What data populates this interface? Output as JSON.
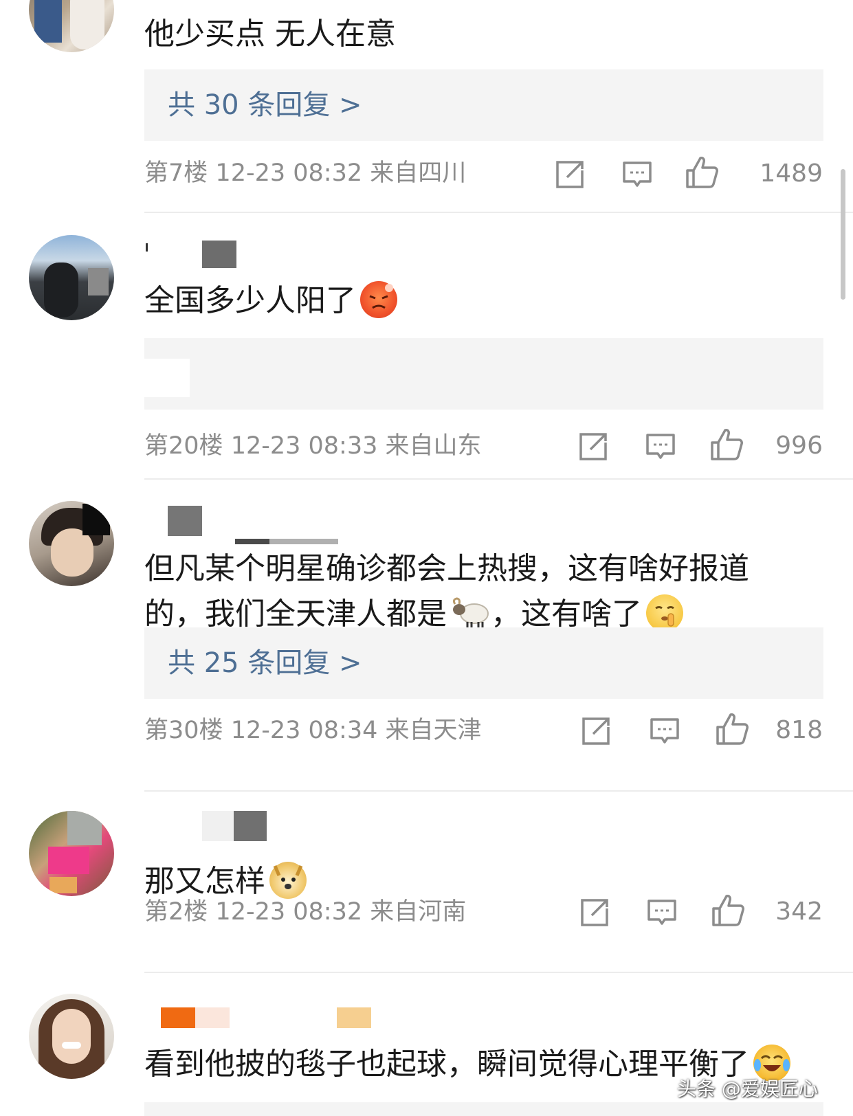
{
  "comments": [
    {
      "text": "他少买点 无人在意",
      "reply_link": "共 30 条回复 >",
      "floor": "第7楼",
      "time": "12-23 08:32",
      "location": "来自四川",
      "likes": "1489"
    },
    {
      "text": "全国多少人阳了",
      "emoji": "angry-face-emoji",
      "floor": "第20楼",
      "time": "12-23 08:33",
      "location": "来自山东",
      "likes": "996"
    },
    {
      "text_line1": "但凡某个明星确诊都会上热搜，这有啥好报道",
      "text_line2_a": "的，我们全天津人都是",
      "text_line2_b": "，这有啥了",
      "emoji_sheep": "sheep-emoji",
      "emoji_shush": "shush-face-emoji",
      "reply_link": "共 25 条回复 >",
      "floor": "第30楼",
      "time": "12-23 08:34",
      "location": "来自天津",
      "likes": "818"
    },
    {
      "text": "那又怎样",
      "emoji": "doge-emoji",
      "floor": "第2楼",
      "time": "12-23 08:32",
      "location": "来自河南",
      "likes": "342"
    },
    {
      "text": "看到他披的毯子也起球，瞬间觉得心理平衡了",
      "emoji": "laughing-crying-emoji"
    }
  ],
  "watermark": "头条 @爱娱匠心",
  "colors": {
    "link": "#4e6f94",
    "meta": "#8c8c8c",
    "reply_bg": "#f4f4f4"
  }
}
